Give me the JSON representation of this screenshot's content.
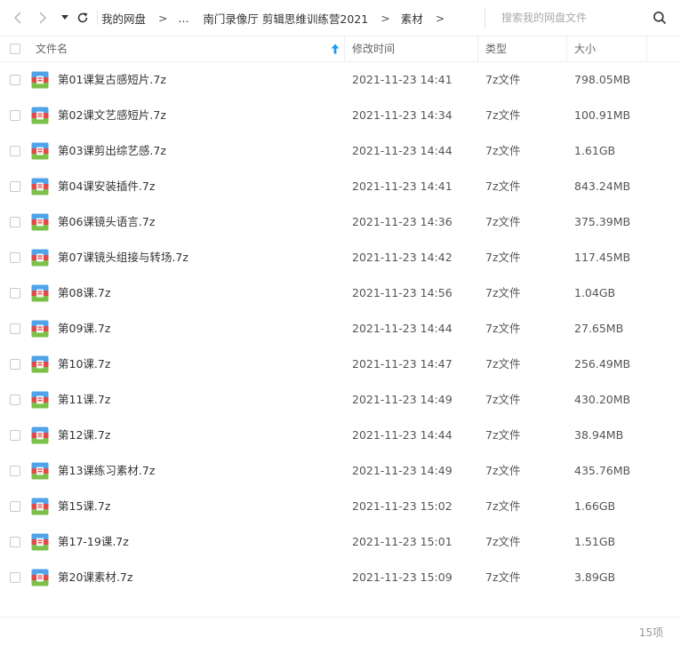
{
  "breadcrumb": {
    "items": [
      "我的网盘",
      "...",
      "南门录像厅 剪辑思维训练营2021",
      "素材"
    ],
    "separator": ">"
  },
  "search": {
    "placeholder": "搜索我的网盘文件"
  },
  "table": {
    "columns": {
      "name": "文件名",
      "modified": "修改时间",
      "type": "类型",
      "size": "大小"
    },
    "sort": {
      "column": "name",
      "direction": "asc"
    },
    "rows": [
      {
        "name": "第01课复古感短片.7z",
        "modified": "2021-11-23 14:41",
        "type": "7z文件",
        "size": "798.05MB"
      },
      {
        "name": "第02课文艺感短片.7z",
        "modified": "2021-11-23 14:34",
        "type": "7z文件",
        "size": "100.91MB"
      },
      {
        "name": "第03课剪出综艺感.7z",
        "modified": "2021-11-23 14:44",
        "type": "7z文件",
        "size": "1.61GB"
      },
      {
        "name": "第04课安装插件.7z",
        "modified": "2021-11-23 14:41",
        "type": "7z文件",
        "size": "843.24MB"
      },
      {
        "name": "第06课镜头语言.7z",
        "modified": "2021-11-23 14:36",
        "type": "7z文件",
        "size": "375.39MB"
      },
      {
        "name": "第07课镜头组接与转场.7z",
        "modified": "2021-11-23 14:42",
        "type": "7z文件",
        "size": "117.45MB"
      },
      {
        "name": "第08课.7z",
        "modified": "2021-11-23 14:56",
        "type": "7z文件",
        "size": "1.04GB"
      },
      {
        "name": "第09课.7z",
        "modified": "2021-11-23 14:44",
        "type": "7z文件",
        "size": "27.65MB"
      },
      {
        "name": "第10课.7z",
        "modified": "2021-11-23 14:47",
        "type": "7z文件",
        "size": "256.49MB"
      },
      {
        "name": "第11课.7z",
        "modified": "2021-11-23 14:49",
        "type": "7z文件",
        "size": "430.20MB"
      },
      {
        "name": "第12课.7z",
        "modified": "2021-11-23 14:44",
        "type": "7z文件",
        "size": "38.94MB"
      },
      {
        "name": "第13课练习素材.7z",
        "modified": "2021-11-23 14:49",
        "type": "7z文件",
        "size": "435.76MB"
      },
      {
        "name": "第15课.7z",
        "modified": "2021-11-23 15:02",
        "type": "7z文件",
        "size": "1.66GB"
      },
      {
        "name": "第17-19课.7z",
        "modified": "2021-11-23 15:01",
        "type": "7z文件",
        "size": "1.51GB"
      },
      {
        "name": "第20课素材.7z",
        "modified": "2021-11-23 15:09",
        "type": "7z文件",
        "size": "3.89GB"
      }
    ]
  },
  "footer": {
    "item_count": "15项"
  },
  "icons": {
    "back": "chevron-left-icon",
    "forward": "chevron-right-icon",
    "history": "caret-down-icon",
    "refresh": "refresh-icon",
    "search": "search-icon",
    "sort": "sort-up-icon",
    "file": "archive-7z-icon"
  },
  "colors": {
    "sort_arrow": "#1e9bf0",
    "border": "#eeeeee",
    "text": "#333333",
    "muted": "#999999"
  }
}
